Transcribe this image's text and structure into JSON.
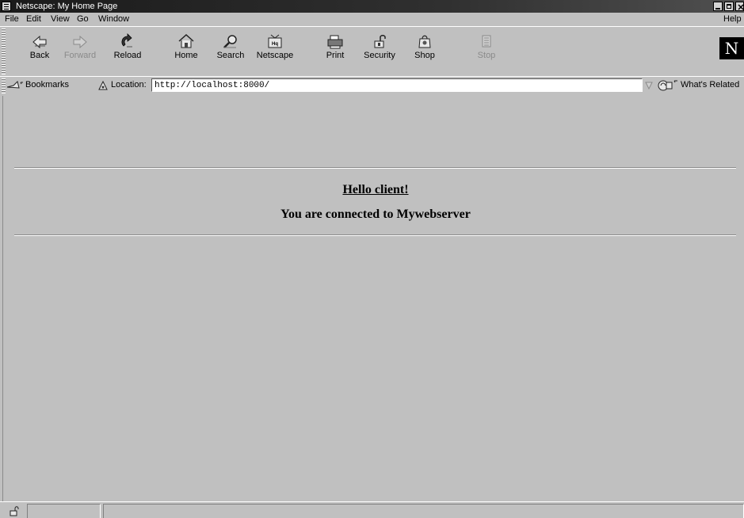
{
  "window": {
    "title": "Netscape: My Home Page"
  },
  "menubar": {
    "items": [
      "File",
      "Edit",
      "View",
      "Go",
      "Window"
    ],
    "help": "Help"
  },
  "toolbar": {
    "buttons": [
      {
        "label": "Back",
        "icon": "back-arrow-icon",
        "enabled": true
      },
      {
        "label": "Forward",
        "icon": "forward-arrow-icon",
        "enabled": false
      },
      {
        "label": "Reload",
        "icon": "reload-icon",
        "enabled": true
      },
      {
        "label": "Home",
        "icon": "home-icon",
        "enabled": true
      },
      {
        "label": "Search",
        "icon": "search-icon",
        "enabled": true
      },
      {
        "label": "Netscape",
        "icon": "netscape-icon",
        "enabled": true
      },
      {
        "label": "Print",
        "icon": "print-icon",
        "enabled": true
      },
      {
        "label": "Security",
        "icon": "security-lock-icon",
        "enabled": true
      },
      {
        "label": "Shop",
        "icon": "shop-icon",
        "enabled": true
      },
      {
        "label": "Stop",
        "icon": "stop-icon",
        "enabled": false
      }
    ],
    "logo_letter": "N"
  },
  "location_bar": {
    "bookmarks_label": "Bookmarks",
    "location_label": "Location:",
    "url": "http://localhost:8000/",
    "whats_related": "What's Related"
  },
  "page": {
    "heading": "Hello client!",
    "subheading": "You are connected to Mywebserver"
  }
}
